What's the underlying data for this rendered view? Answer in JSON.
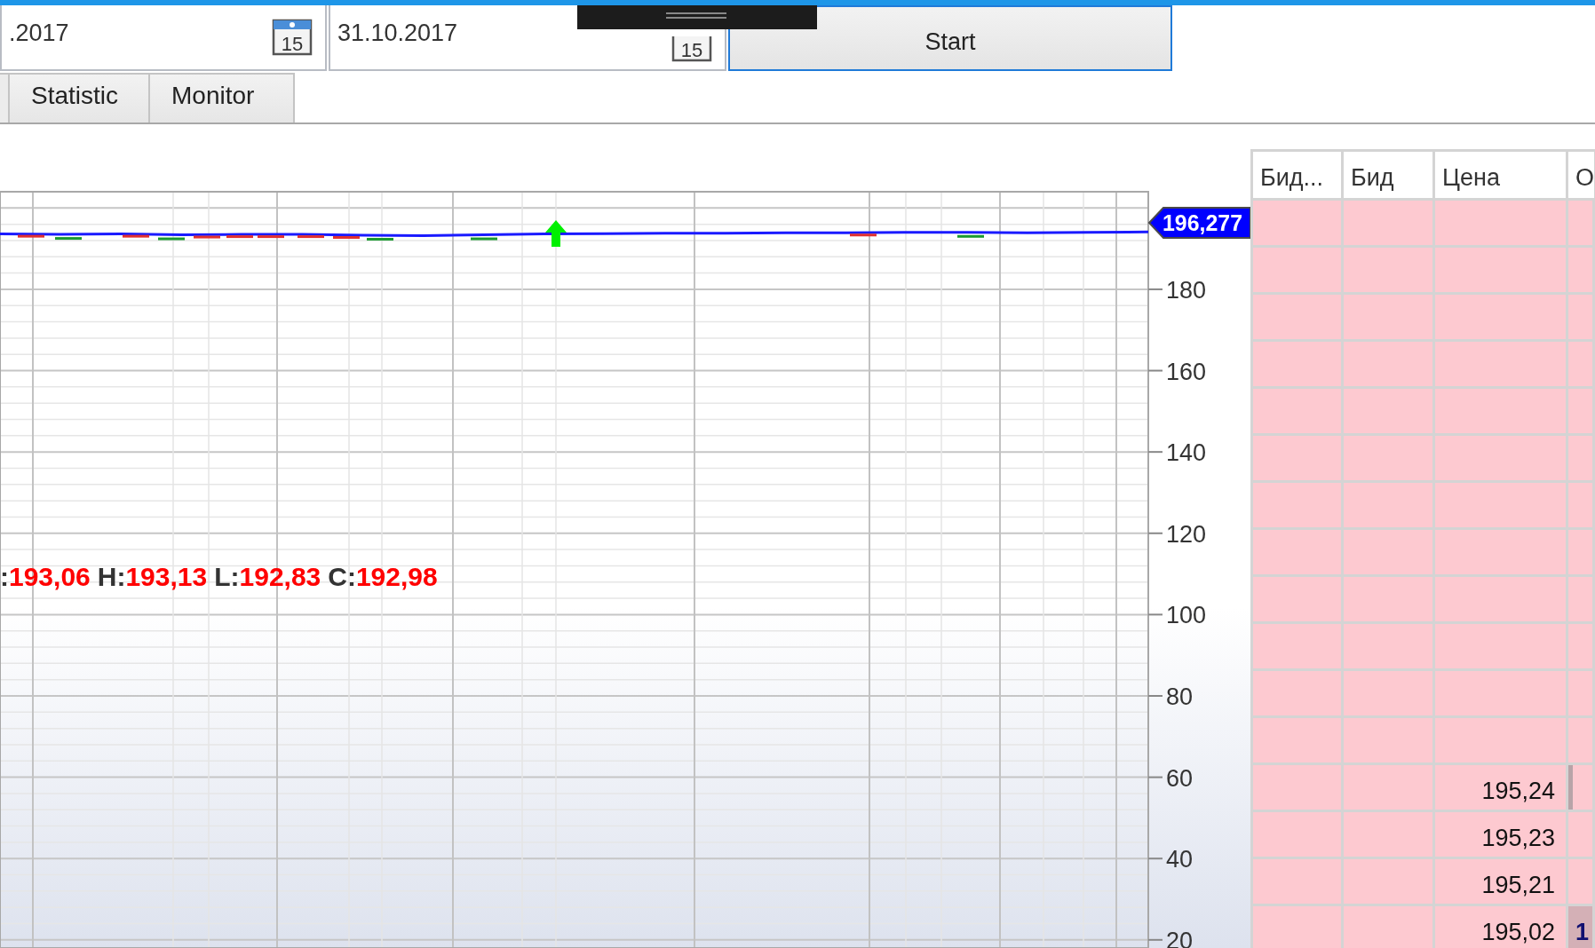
{
  "toolbar": {
    "date_fields": [
      {
        "value": ".2017",
        "calendar_day": "15"
      },
      {
        "value": "31.10.2017",
        "calendar_day": "15"
      }
    ],
    "start_button": {
      "label": "Start"
    }
  },
  "tabs": [
    {
      "label": "Statistic",
      "selected": false
    },
    {
      "label": "Monitor",
      "selected": false
    }
  ],
  "chart": {
    "chart_data": {
      "type": "line",
      "grid": true,
      "ylim": [
        18,
        204
      ],
      "yticks": [
        20,
        40,
        60,
        80,
        100,
        120,
        140,
        160,
        180
      ],
      "series": [
        {
          "color": "#1a1aff",
          "values": [
            193.6,
            193.5,
            193.6,
            193.4,
            193.5,
            193.5,
            193.3,
            193.2,
            193.4,
            193.6,
            193.7,
            193.8,
            193.8,
            193.9,
            193.9,
            194.0,
            194.0,
            193.9,
            194.0,
            194.1
          ]
        }
      ]
    },
    "price_label": "196,277",
    "ohlc_legend": [
      {
        "label": ":",
        "value": "193,06"
      },
      {
        "label": "H:",
        "value": "193,13"
      },
      {
        "label": "L:",
        "value": "192,83"
      },
      {
        "label": "C:",
        "value": "192,98"
      }
    ]
  },
  "order_book": {
    "columns": [
      "Бид...",
      "Бид",
      "Цена",
      "О"
    ],
    "rows": [
      {},
      {},
      {},
      {},
      {},
      {},
      {},
      {},
      {},
      {},
      {},
      {},
      {
        "price": "195,24",
        "bar": true
      },
      {
        "price": "195,23"
      },
      {
        "price": "195,21"
      },
      {
        "price": "195,02",
        "column_4": "1",
        "highlighted": true
      }
    ]
  }
}
